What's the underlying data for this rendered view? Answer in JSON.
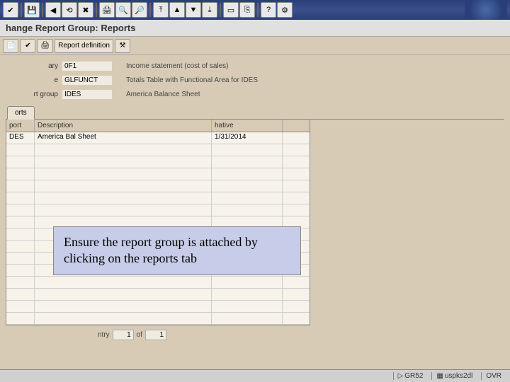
{
  "title": "hange Report Group: Reports",
  "app_toolbar": {
    "report_definition": "Report definition"
  },
  "form": {
    "rows": [
      {
        "label": "ary",
        "value": "0F1",
        "desc": "Income statement (cost of sales)"
      },
      {
        "label": "e",
        "value": "GLFUNCT",
        "desc": "Totals Table with Functional Area for IDES"
      },
      {
        "label": "rt group",
        "value": "IDES",
        "desc": "America Balance Sheet"
      }
    ]
  },
  "tabs": {
    "reports": "orts"
  },
  "grid": {
    "headers": {
      "c1": "port",
      "c2": "Description",
      "c3": "hative"
    },
    "rows": [
      {
        "c1": "DES",
        "c2": "America Bal Sheet",
        "c3": "1/31/2014"
      },
      {
        "c1": "",
        "c2": "",
        "c3": ""
      },
      {
        "c1": "",
        "c2": "",
        "c3": ""
      },
      {
        "c1": "",
        "c2": "",
        "c3": ""
      },
      {
        "c1": "",
        "c2": "",
        "c3": ""
      },
      {
        "c1": "",
        "c2": "",
        "c3": ""
      },
      {
        "c1": "",
        "c2": "",
        "c3": ""
      },
      {
        "c1": "",
        "c2": "",
        "c3": ""
      },
      {
        "c1": "",
        "c2": "",
        "c3": ""
      },
      {
        "c1": "",
        "c2": "",
        "c3": ""
      },
      {
        "c1": "",
        "c2": "",
        "c3": ""
      },
      {
        "c1": "",
        "c2": "",
        "c3": ""
      },
      {
        "c1": "",
        "c2": "",
        "c3": ""
      },
      {
        "c1": "",
        "c2": "",
        "c3": ""
      },
      {
        "c1": "",
        "c2": "",
        "c3": ""
      },
      {
        "c1": "",
        "c2": "",
        "c3": ""
      }
    ]
  },
  "pager": {
    "entry_label": "ntry",
    "entry_val": "1",
    "of_label": "of",
    "of_val": "1"
  },
  "callout": "Ensure the report group is attached by clicking on the reports tab",
  "status": {
    "tcode": "GR52",
    "host": "uspks2dl",
    "mode": "OVR"
  }
}
